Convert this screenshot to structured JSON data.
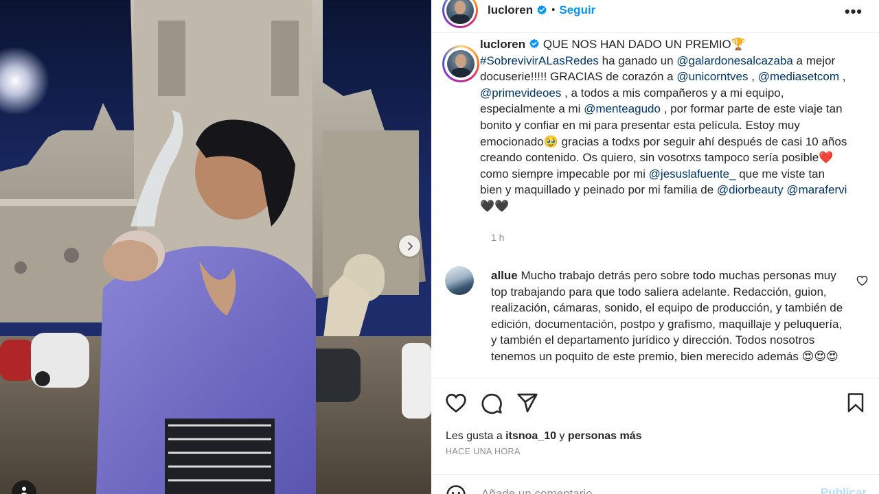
{
  "post": {
    "username": "lucloren",
    "follow_label": "Seguir",
    "dot": "•",
    "more": "•••"
  },
  "caption": {
    "username": "lucloren",
    "t1": " QUE NOS HAN DADO UN PREMIO🏆 ",
    "hashtag": "#SobrevivirALasRedes",
    "t2": " ha ganado un ",
    "m1": "@galardonesalcazaba",
    "t3": " a mejor docuserie!!!!! GRACIAS de corazón a ",
    "m2": "@unicorntves",
    "t4": " , ",
    "m3": "@mediasetcom",
    "t5": " , ",
    "m4": "@primevideoes",
    "t6": " , a todos a mis compañeros y a mi equipo, especialmente a mi ",
    "m5": "@menteagudo",
    "t7": " , por formar parte de este viaje tan bonito y confiar en mi para presentar esta película. Estoy muy emocionado🥹 gracias a todxs por seguir ahí después de casi 10 años creando contenido. Os quiero, sin vosotrxs tampoco sería posible❤️ como siempre impecable por mi ",
    "m6": "@jesuslafuente_",
    "t8": " que me viste tan bien y maquillado y peinado por mi familia de ",
    "m7": "@diorbeauty",
    "t9": " ",
    "m8": "@marafervi",
    "t10": " 🖤🖤",
    "time": "1 h"
  },
  "comment": {
    "username": "allue",
    "text": " Mucho trabajo detrás pero sobre todo muchas personas muy top trabajando para que todo saliera adelante. Redacción, guion, realización, cámaras, sonido, el equipo de producción, y también de edición, documentación, postpo y grafismo, maquillaje y peluquería, y también el departamento jurídico y dirección. Todos nosotros tenemos un poquito de este premio, bien merecido además 😍😍😍"
  },
  "likes": {
    "prefix": "Les gusta a ",
    "user": "itsnoa_10",
    "mid": " y ",
    "others": "personas más"
  },
  "time_ago": "HACE UNA HORA",
  "add_comment": {
    "placeholder": "Añade un comentario...",
    "publish": "Publicar"
  },
  "colors": {
    "link": "#00376b",
    "follow": "#0095f6",
    "verified": "#0095f6",
    "publish_disabled": "#b2dffc",
    "muted": "#8e8e8e"
  },
  "icons": [
    "verified-badge-icon",
    "more-options-icon",
    "heart-icon",
    "comment-icon",
    "share-icon",
    "bookmark-icon",
    "emoji-icon",
    "chevron-right-icon",
    "person-tag-icon"
  ]
}
